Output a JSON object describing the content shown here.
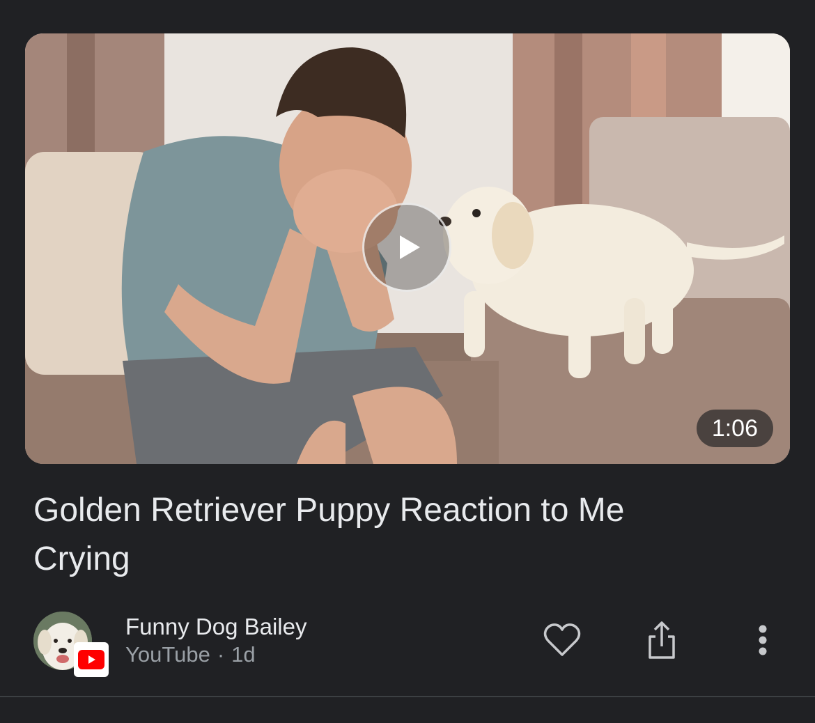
{
  "video": {
    "duration": "1:06",
    "title": "Golden Retriever Puppy Reaction to Me Crying",
    "thumbnail_icon": "video-thumbnail",
    "play_icon": "play-icon"
  },
  "channel": {
    "name": "Funny Dog Bailey",
    "source": "YouTube",
    "separator": "·",
    "age": "1d",
    "avatar_icon": "dog-avatar",
    "source_badge_icon": "youtube-icon"
  },
  "actions": {
    "like_icon": "heart-icon",
    "share_icon": "share-icon",
    "more_icon": "more-vertical-icon"
  },
  "colors": {
    "background": "#202124",
    "text_primary": "#e8eaed",
    "text_secondary": "#9aa0a6",
    "youtube_red": "#ff0000"
  }
}
